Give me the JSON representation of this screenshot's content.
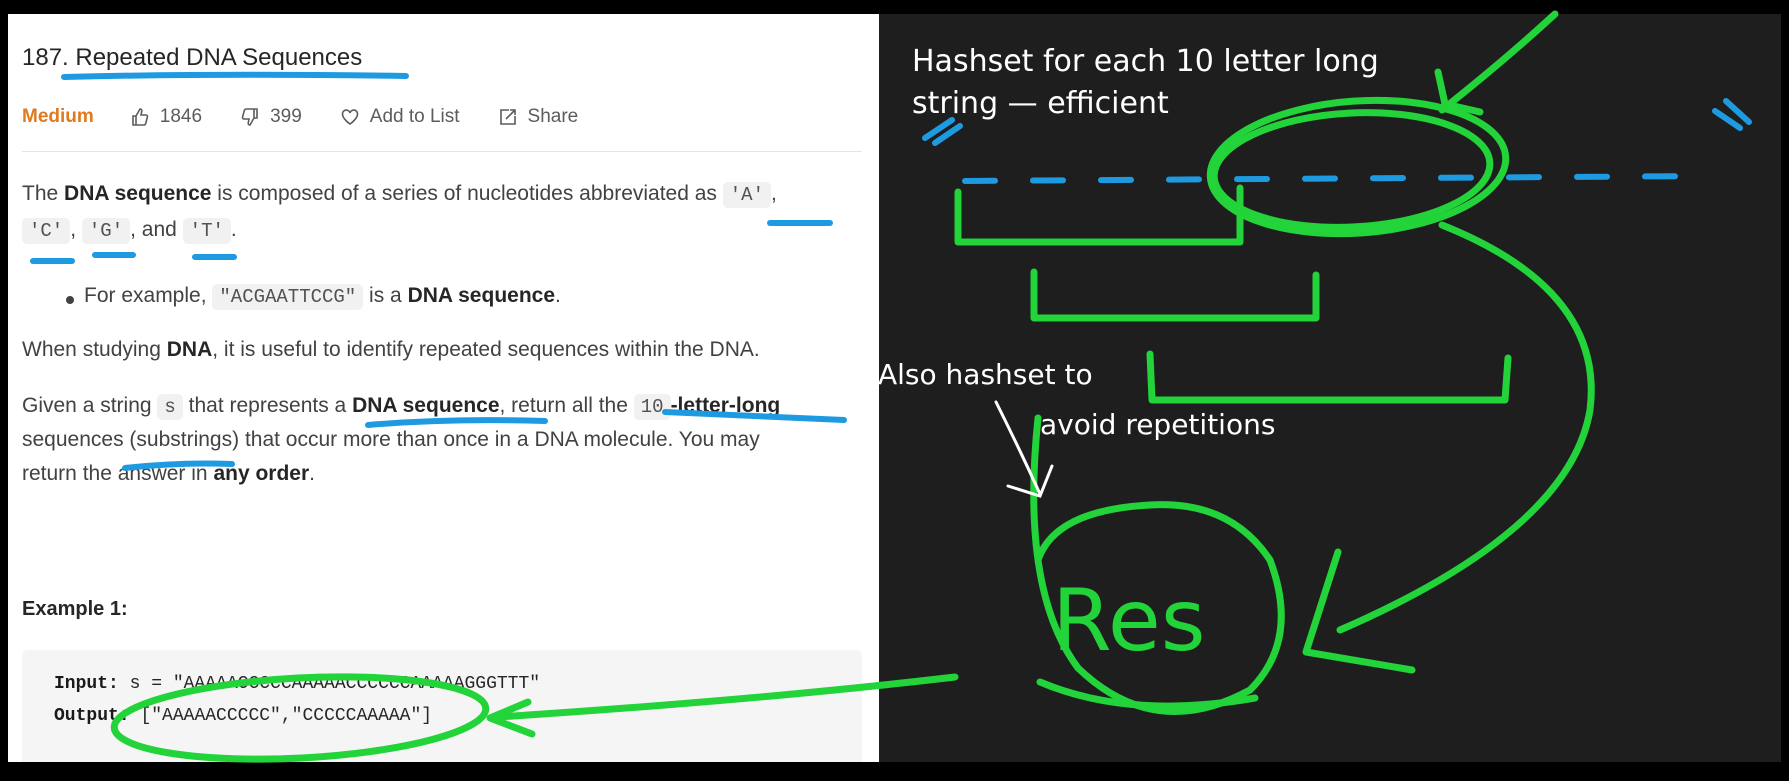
{
  "problem": {
    "title": "187. Repeated DNA Sequences",
    "difficulty": "Medium",
    "likes": "1846",
    "dislikes": "399",
    "add_to_list": "Add to List",
    "share": "Share"
  },
  "description": {
    "p1_a": "The ",
    "p1_b": "DNA sequence",
    "p1_c": " is composed of a series of nucleotides abbreviated as ",
    "code_A": "'A'",
    "comma": ",",
    "code_C": "'C'",
    "code_G": "'G'",
    "and": ", and ",
    "code_T": "'T'",
    "period": ".",
    "bullet_a": "For example, ",
    "bullet_code": "\"ACGAATTCCG\"",
    "bullet_b": " is a ",
    "bullet_bold": "DNA sequence",
    "p2_a": "When studying ",
    "p2_b": "DNA",
    "p2_c": ", it is useful to identify repeated sequences within the DNA.",
    "p3_a": "Given a string ",
    "p3_code": "s",
    "p3_b": " that represents a ",
    "p3_bold": "DNA sequence",
    "p3_c": ", return all the ",
    "p3_code2": "10",
    "p3_bold2": "-letter-long",
    "p3_line2": "sequences (substrings) that occur more than once in a DNA molecule. You may",
    "p3_line3_a": "return the answer in ",
    "p3_line3_b": "any order",
    "p3_line3_c": "."
  },
  "example": {
    "heading": "Example 1:",
    "input_label": "Input:",
    "input_value": "s = \"AAAAACCCCCAAAAACCCCCCAAAAAGGGTTT\"",
    "output_label": "Output:",
    "output_value": "[\"AAAAACCCCC\",\"CCCCCAAAAA\"]"
  },
  "annotations": {
    "note1_line1": "Hashset for each 10 letter long",
    "note1_line2": "string — efficient",
    "note2_line1": "Also hashset to",
    "note2_line2": "avoid repetitions",
    "res": "Res"
  },
  "colors": {
    "panel_bg": "#ffffff",
    "board_bg": "#1e1e1e",
    "difficulty": "#e07a1f",
    "pen_green": "#22d33a",
    "pen_blue": "#1e9be0",
    "pen_white": "#ffffff"
  },
  "icons": [
    "thumbs-up-icon",
    "thumbs-down-icon",
    "heart-icon",
    "share-icon"
  ]
}
